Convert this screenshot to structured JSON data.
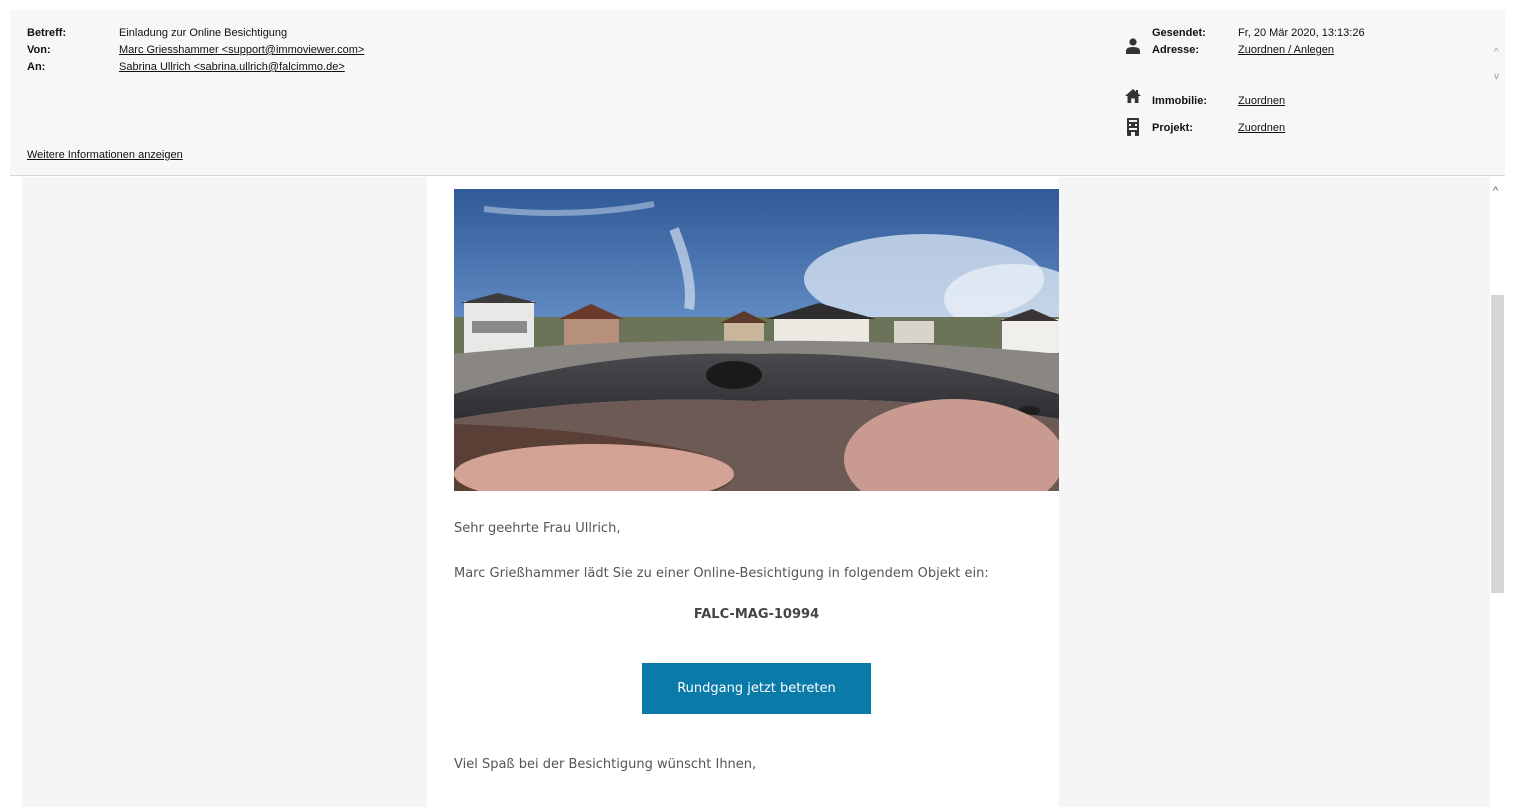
{
  "header": {
    "subject_label": "Betreff:",
    "subject_value": "Einladung zur Online Besichtigung",
    "from_label": "Von:",
    "from_value": "Marc Griesshammer <support@immoviewer.com>",
    "to_label": "An:",
    "to_value": "Sabrina Ullrich <sabrina.ullrich@falcimmo.de>",
    "more_info_link": "Weitere Informationen anzeigen",
    "sent_label": "Gesendet:",
    "sent_value": "Fr, 20 Mär 2020, 13:13:26",
    "address_label": "Adresse:",
    "address_link": "Zuordnen / Anlegen",
    "property_label": "Immobilie:",
    "property_link": "Zuordnen",
    "project_label": "Projekt:",
    "project_link": "Zuordnen"
  },
  "icons": {
    "person": "person-icon",
    "home": "home-icon",
    "building": "building-icon",
    "scroll_up": "chevron-up-icon",
    "scroll_down": "chevron-down-icon"
  },
  "scroll_arrows": {
    "up": "^",
    "down": "v"
  },
  "mail": {
    "greeting": "Sehr geehrte Frau Ullrich,",
    "invitation": "Marc Grießhammer lädt Sie zu einer Online-Besichtigung in folgendem Objekt ein:",
    "object_code": "FALC-MAG-10994",
    "cta_label": "Rundgang jetzt betreten",
    "closing": "Viel Spaß bei der Besichtigung wünscht Ihnen,"
  },
  "colors": {
    "cta_background": "#0a7aa9",
    "header_background": "#f7f7f7",
    "body_background": "#f5f5f5"
  }
}
